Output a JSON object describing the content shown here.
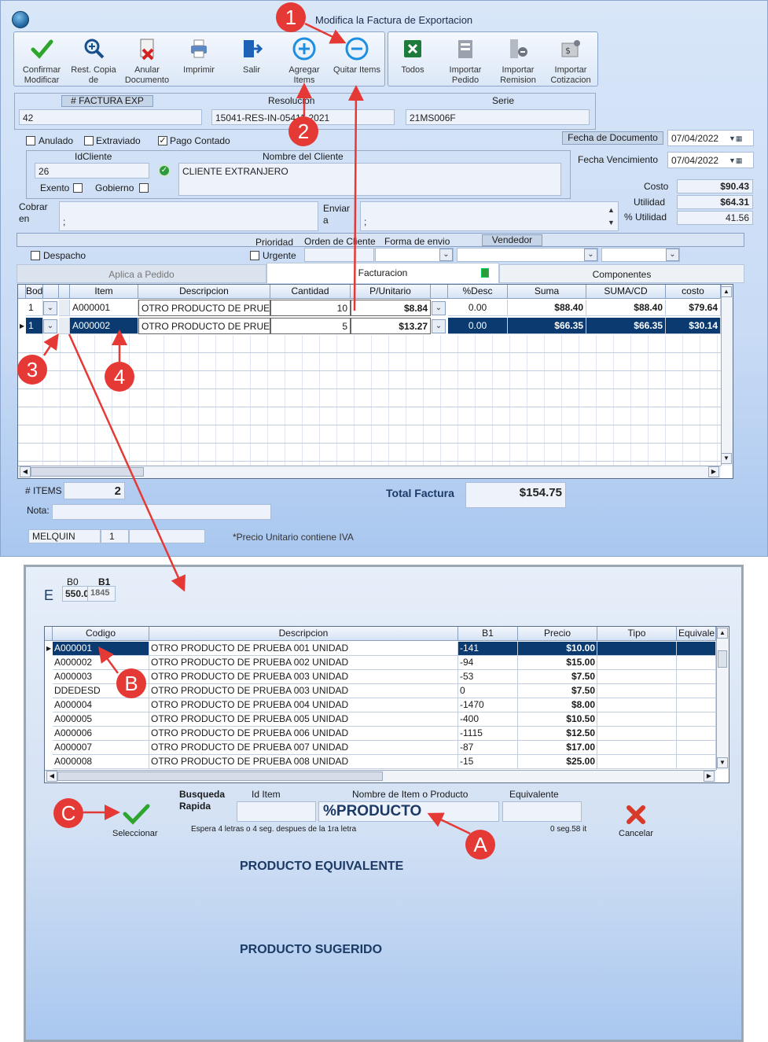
{
  "window": {
    "title": "Modifica la Factura de Exportacion"
  },
  "toolbar": {
    "confirm": "Confirmar Modificar",
    "rest_copy": "Rest. Copia de",
    "cancel_doc": "Anular Documento",
    "print": "Imprimir",
    "exit": "Salir",
    "add_items": "Agregar Items",
    "remove_items": "Quitar Items",
    "all": "Todos",
    "import_order": "Importar Pedido",
    "import_remission": "Importar Remision",
    "import_quote": "Importar Cotizacion"
  },
  "header": {
    "invoice_label": "# FACTURA EXP",
    "invoice_value": "42",
    "resolution_label": "Resolución",
    "resolution_value": "15041-RES-IN-05411-2021",
    "series_label": "Serie",
    "series_value": "21MS006F"
  },
  "flags": {
    "annulled": "Anulado",
    "extraviado": "Extraviado",
    "paid_cash": "Pago Contado",
    "paid_cash_checked": "✓"
  },
  "dates": {
    "doc_date_label": "Fecha de Documento",
    "doc_date": "07/04/2022",
    "due_date_label": "Fecha Vencimiento",
    "due_date": "07/04/2022"
  },
  "client": {
    "id_label": "IdCliente",
    "id_value": "26",
    "name_label": "Nombre del Cliente",
    "name_value": "CLIENTE EXTRANJERO",
    "exempt": "Exento",
    "government": "Gobierno",
    "collect_label": "Cobrar en",
    "collect_value": ";",
    "send_label": "Enviar a",
    "send_value": ";"
  },
  "totals_side": {
    "cost_label": "Costo",
    "cost": "$90.43",
    "utility_label": "Utilidad",
    "utility": "$64.31",
    "pct_label": "% Utilidad",
    "pct": "41.56"
  },
  "priority": {
    "priority": "Prioridad",
    "order": "Orden de Cliente",
    "shipping": "Forma de envio",
    "seller": "Vendedor",
    "dispatch": "Despacho",
    "urgent": "Urgente"
  },
  "tabs": [
    "Aplica a Pedido",
    "Facturacion",
    "Componentes"
  ],
  "grid": {
    "columns": [
      "Bodega",
      "",
      "Item",
      "Descripcion",
      "Cantidad",
      "P/Unitario",
      "%Desc",
      "Suma",
      "SUMA/CD",
      "costo"
    ],
    "rows": [
      [
        "1",
        "A000001",
        "OTRO PRODUCTO DE PRUEBA",
        "10",
        "$8.84",
        "0.00",
        "$88.40",
        "$88.40",
        "$79.64"
      ],
      [
        "1",
        "A000002",
        "OTRO PRODUCTO DE PRUEBA",
        "5",
        "$13.27",
        "0.00",
        "$66.35",
        "$66.35",
        "$30.14"
      ]
    ]
  },
  "footer": {
    "items_label": "# ITEMS",
    "items": "2",
    "total_label": "Total Factura",
    "total": "$154.75",
    "note_label": "Nota:",
    "user": "MELQUIN",
    "user_num": "1",
    "iva_note": "*Precio Unitario contiene IVA"
  },
  "search": {
    "e_label": "E",
    "b0_label": "B0",
    "b0_value": "550.0",
    "b1_label": "B1",
    "b1_value": "1845",
    "columns": [
      "Codigo",
      "Descripcion",
      "B1",
      "Precio",
      "Tipo",
      "Equivale"
    ],
    "rows": [
      [
        "A000001",
        "OTRO PRODUCTO DE PRUEBA 001 UNIDAD",
        "-141",
        "$10.00"
      ],
      [
        "A000002",
        "OTRO PRODUCTO DE PRUEBA 002 UNIDAD",
        "-94",
        "$15.00"
      ],
      [
        "A000003",
        "OTRO PRODUCTO DE PRUEBA 003 UNIDAD",
        "-53",
        "$7.50"
      ],
      [
        "DDEDESD",
        "OTRO PRODUCTO DE PRUEBA 003 UNIDAD",
        "0",
        "$7.50"
      ],
      [
        "A000004",
        "OTRO PRODUCTO DE PRUEBA 004 UNIDAD",
        "-1470",
        "$8.00"
      ],
      [
        "A000005",
        "OTRO PRODUCTO DE PRUEBA 005 UNIDAD",
        "-400",
        "$10.50"
      ],
      [
        "A000006",
        "OTRO PRODUCTO DE PRUEBA 006 UNIDAD",
        "-1115",
        "$12.50"
      ],
      [
        "A000007",
        "OTRO PRODUCTO DE PRUEBA 007 UNIDAD",
        "-87",
        "$17.00"
      ],
      [
        "A000008",
        "OTRO PRODUCTO DE PRUEBA 008 UNIDAD",
        "-15",
        "$25.00"
      ]
    ],
    "quick_label": "Busqueda Rapida",
    "id_item_label": "Id Item",
    "name_label": "Nombre de Item o Producto",
    "name_value": "%PRODUCTO",
    "equiv_label": "Equivalente",
    "hint": "Espera 4 letras o 4 seg. despues de la 1ra letra",
    "timing": "0 seg.58 it",
    "select": "Seleccionar",
    "cancel": "Cancelar",
    "equiv_title": "PRODUCTO EQUIVALENTE",
    "suggested_title": "PRODUCTO SUGERIDO"
  },
  "markers": [
    "1",
    "2",
    "3",
    "4",
    "A",
    "B",
    "C"
  ],
  "colors": {
    "accent": "#0a3a70",
    "marker": "#e53935"
  }
}
